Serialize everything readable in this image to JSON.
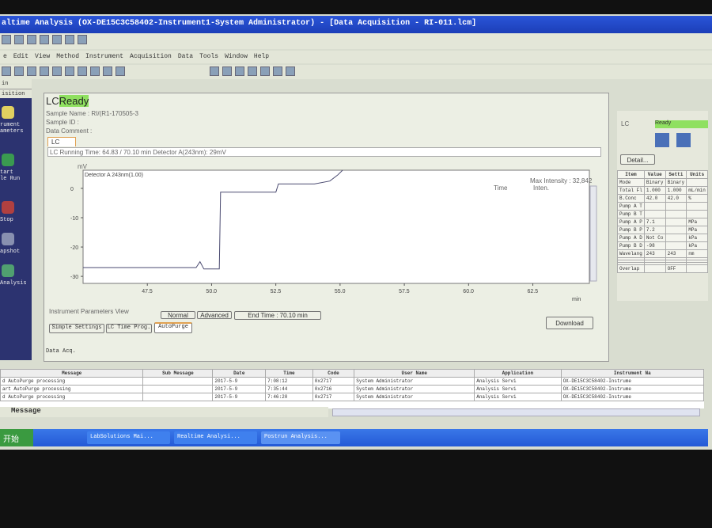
{
  "window": {
    "title": "altime Analysis (OX-DE15C3C58402-Instrument1-System Administrator) - [Data Acquisition - RI-011.lcm]"
  },
  "menu": [
    "e",
    "Edit",
    "View",
    "Method",
    "Instrument",
    "Acquisition",
    "Data",
    "Tools",
    "Window",
    "Help"
  ],
  "sidebar": {
    "header1": "in",
    "header2": "isition",
    "items": [
      {
        "label": "rument\nameters",
        "color": "#e0d060"
      },
      {
        "label": "tart\nle Run",
        "color": "#3a9a50"
      },
      {
        "label": "Stop",
        "color": "#b04040"
      },
      {
        "label": "apshot",
        "color": "#8890b0"
      },
      {
        "label": "Analysis",
        "color": "#50a070"
      }
    ]
  },
  "main": {
    "lc_label": "LC",
    "status": "Ready",
    "sample_name": "Sample Name : RI/(R1-170505-3",
    "sample_id": "Sample ID :",
    "data_comment": "Data Comment :",
    "tab": "LC",
    "running": "LC Running Time: 64.83 / 70.10 min Detector A(243nm): 29mV",
    "max_intensity": "Max Intensity : 32,842",
    "col_time": "Time",
    "col_inten": "Inten.",
    "params_view": "Instrument Parameters View",
    "normal": "Normal",
    "advanced": "Advanced",
    "end_time": "End Time : 70.10 min",
    "download": "Download",
    "subtabs": [
      "Simple Settings",
      "LC Time Prog.",
      "AutoPurge"
    ],
    "data_acq": "Data Acq."
  },
  "chart_data": {
    "type": "line",
    "ylabel": "mV",
    "xlabel": "min",
    "legend": "Detector A 243nm(1.00)",
    "xlim": [
      45,
      64.7
    ],
    "ylim": [
      -32.4,
      6.2
    ],
    "xticks": [
      47.5,
      50.0,
      52.5,
      55.0,
      57.5,
      60.0,
      62.5
    ],
    "yticks": [
      0,
      -10,
      -20,
      -30
    ],
    "x": [
      45,
      49.4,
      49.55,
      49.7,
      50.3,
      50.35,
      52.5,
      52.6,
      54,
      54.6,
      54.9,
      55.1
    ],
    "y": [
      -27,
      -27,
      -25,
      -27.5,
      -27.5,
      -1.3,
      -1.3,
      1.5,
      1.5,
      2.5,
      4.5,
      6.2
    ]
  },
  "right": {
    "lc": "LC",
    "status": "Ready",
    "detail": "Detail...",
    "headers": [
      "Item",
      "Value",
      "Setti",
      "Units"
    ],
    "rows": [
      [
        "Mode",
        "Binary",
        "Binary",
        ""
      ],
      [
        "Total Fl",
        "1.000",
        "1.000",
        "mL/min"
      ],
      [
        "B.Conc",
        "42.0",
        "42.0",
        "%"
      ],
      [
        "Pump A T",
        "",
        "",
        ""
      ],
      [
        "Pump B T",
        "",
        "",
        ""
      ],
      [
        "Pump A P",
        "7.1",
        "",
        "MPa"
      ],
      [
        "Pump B P",
        "7.2",
        "",
        "MPa"
      ],
      [
        "Pump A D",
        "Not Co",
        "",
        "kPa"
      ],
      [
        "Pump B D",
        "-98",
        "",
        "kPa"
      ],
      [
        "Wavelang",
        "243",
        "243",
        "nm"
      ],
      [
        "",
        "",
        "",
        ""
      ],
      [
        "",
        "",
        "",
        ""
      ],
      [
        "",
        "",
        "",
        ""
      ],
      [
        "Overlap",
        "",
        "OFF",
        ""
      ]
    ]
  },
  "messages": {
    "headers": [
      "Message",
      "Sub Message",
      "Date",
      "Time",
      "Code",
      "User Name",
      "Application",
      "Instrument Na"
    ],
    "rows": [
      [
        "d AutoPurge processing",
        "",
        "2017-5-9",
        "7:08:12",
        "0x2717",
        "System Administrator",
        "Analysis Servi",
        "OX-DE15C3C58402-Instrume"
      ],
      [
        "art AutoPurge processing",
        "",
        "2017-5-9",
        "7:35:44",
        "0x2716",
        "System Administrator",
        "Analysis Servi",
        "OX-DE15C3C58402-Instrume"
      ],
      [
        "d AutoPurge processing",
        "",
        "2017-5-9",
        "7:46:20",
        "0x2717",
        "System Administrator",
        "Analysis Servi",
        "OX-DE15C3C58402-Instrume"
      ]
    ],
    "tab": "Message"
  },
  "taskbar": {
    "start": "开始",
    "tasks": [
      "LabSolutions Mai...",
      "Realtime Analysi...",
      "Postrun Analysis..."
    ]
  }
}
